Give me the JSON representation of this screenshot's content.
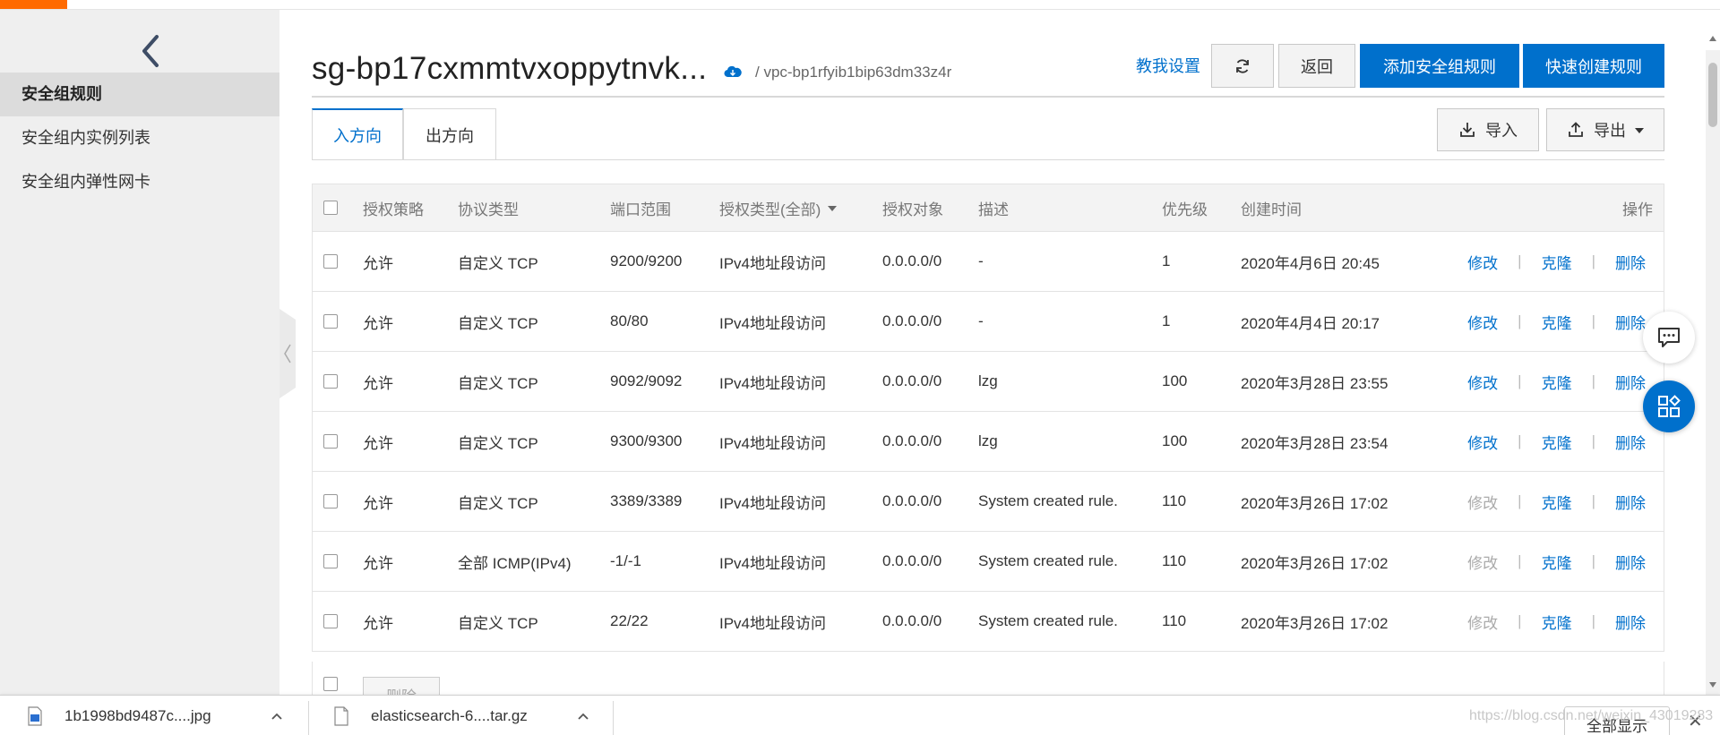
{
  "sidebar": {
    "back_label": "",
    "items": [
      {
        "label": "安全组规则",
        "active": true
      },
      {
        "label": "安全组内实例列表",
        "active": false
      },
      {
        "label": "安全组内弹性网卡",
        "active": false
      }
    ]
  },
  "header": {
    "title": "sg-bp17cxmmtvxoppytnvk...",
    "vpc_path": "/ vpc-bp1rfyib1bip63dm33z4r",
    "guide_link": "教我设置",
    "return_label": "返回",
    "add_rule_label": "添加安全组规则",
    "quick_create_label": "快速创建规则"
  },
  "tabs": [
    {
      "label": "入方向",
      "active": true
    },
    {
      "label": "出方向",
      "active": false
    }
  ],
  "toolbar": {
    "import_label": "导入",
    "export_label": "导出"
  },
  "table": {
    "columns": {
      "policy": "授权策略",
      "protocol": "协议类型",
      "port": "端口范围",
      "auth_type": "授权类型(全部)",
      "target": "授权对象",
      "desc": "描述",
      "priority": "优先级",
      "created": "创建时间",
      "ops": "操作"
    },
    "op_labels": {
      "edit": "修改",
      "clone": "克隆",
      "delete": "删除"
    },
    "rows": [
      {
        "policy": "允许",
        "protocol": "自定义 TCP",
        "port": "9200/9200",
        "auth_type": "IPv4地址段访问",
        "target": "0.0.0.0/0",
        "desc": "-",
        "priority": "1",
        "created": "2020年4月6日 20:45",
        "edit_enabled": true
      },
      {
        "policy": "允许",
        "protocol": "自定义 TCP",
        "port": "80/80",
        "auth_type": "IPv4地址段访问",
        "target": "0.0.0.0/0",
        "desc": "-",
        "priority": "1",
        "created": "2020年4月4日 20:17",
        "edit_enabled": true
      },
      {
        "policy": "允许",
        "protocol": "自定义 TCP",
        "port": "9092/9092",
        "auth_type": "IPv4地址段访问",
        "target": "0.0.0.0/0",
        "desc": "lzg",
        "priority": "100",
        "created": "2020年3月28日 23:55",
        "edit_enabled": true
      },
      {
        "policy": "允许",
        "protocol": "自定义 TCP",
        "port": "9300/9300",
        "auth_type": "IPv4地址段访问",
        "target": "0.0.0.0/0",
        "desc": "lzg",
        "priority": "100",
        "created": "2020年3月28日 23:54",
        "edit_enabled": true
      },
      {
        "policy": "允许",
        "protocol": "自定义 TCP",
        "port": "3389/3389",
        "auth_type": "IPv4地址段访问",
        "target": "0.0.0.0/0",
        "desc": "System created rule.",
        "priority": "110",
        "created": "2020年3月26日 17:02",
        "edit_enabled": false
      },
      {
        "policy": "允许",
        "protocol": "全部 ICMP(IPv4)",
        "port": "-1/-1",
        "auth_type": "IPv4地址段访问",
        "target": "0.0.0.0/0",
        "desc": "System created rule.",
        "priority": "110",
        "created": "2020年3月26日 17:02",
        "edit_enabled": false
      },
      {
        "policy": "允许",
        "protocol": "自定义 TCP",
        "port": "22/22",
        "auth_type": "IPv4地址段访问",
        "target": "0.0.0.0/0",
        "desc": "System created rule.",
        "priority": "110",
        "created": "2020年3月26日 17:02",
        "edit_enabled": false
      }
    ],
    "bulk_delete_label": "删除"
  },
  "downloads": {
    "items": [
      {
        "name": "1b1998bd9487c....jpg",
        "icon": "image-file-icon"
      },
      {
        "name": "elasticsearch-6....tar.gz",
        "icon": "file-icon"
      }
    ],
    "show_all_label": "全部显示"
  },
  "watermark": "https://blog.csdn.net/weixin_43019283",
  "colors": {
    "accent": "#0070cc",
    "brand": "#ff6a00",
    "disabled": "#aaaaaa"
  }
}
